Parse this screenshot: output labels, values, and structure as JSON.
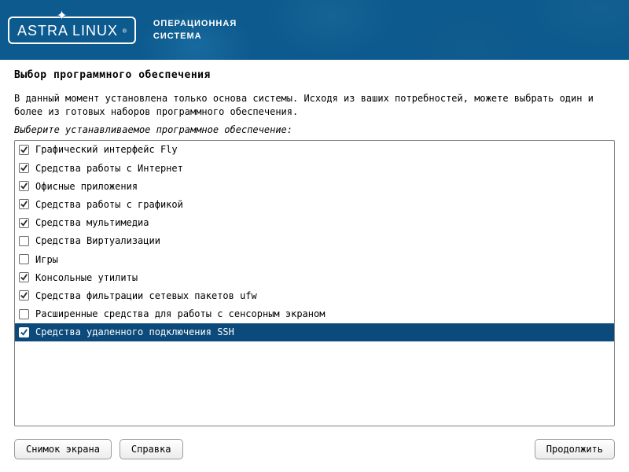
{
  "header": {
    "logo_text": "ASTRA LINUX",
    "logo_reg": "®",
    "subtitle_line1": "ОПЕРАЦИОННАЯ",
    "subtitle_line2": "СИСТЕМА"
  },
  "title": "Выбор программного обеспечения",
  "description": "В данный момент установлена только основа системы. Исходя из ваших потребностей, можете выбрать один и более из готовых наборов программного обеспечения.",
  "prompt": "Выберите устанавливаемое программное обеспечение:",
  "items": [
    {
      "label": "Графический интерфейс Fly",
      "checked": true,
      "selected": false
    },
    {
      "label": "Средства работы с Интернет",
      "checked": true,
      "selected": false
    },
    {
      "label": "Офисные приложения",
      "checked": true,
      "selected": false
    },
    {
      "label": "Средства работы с графикой",
      "checked": true,
      "selected": false
    },
    {
      "label": "Средства мультимедиа",
      "checked": true,
      "selected": false
    },
    {
      "label": "Средства Виртуализации",
      "checked": false,
      "selected": false
    },
    {
      "label": "Игры",
      "checked": false,
      "selected": false
    },
    {
      "label": "Консольные утилиты",
      "checked": true,
      "selected": false
    },
    {
      "label": "Средства фильтрации сетевых пакетов ufw",
      "checked": true,
      "selected": false
    },
    {
      "label": "Расширенные средства для работы с сенсорным экраном",
      "checked": false,
      "selected": false
    },
    {
      "label": "Средства удаленного подключения SSH",
      "checked": true,
      "selected": true
    }
  ],
  "buttons": {
    "screenshot": "Снимок экрана",
    "help": "Справка",
    "continue": "Продолжить"
  }
}
